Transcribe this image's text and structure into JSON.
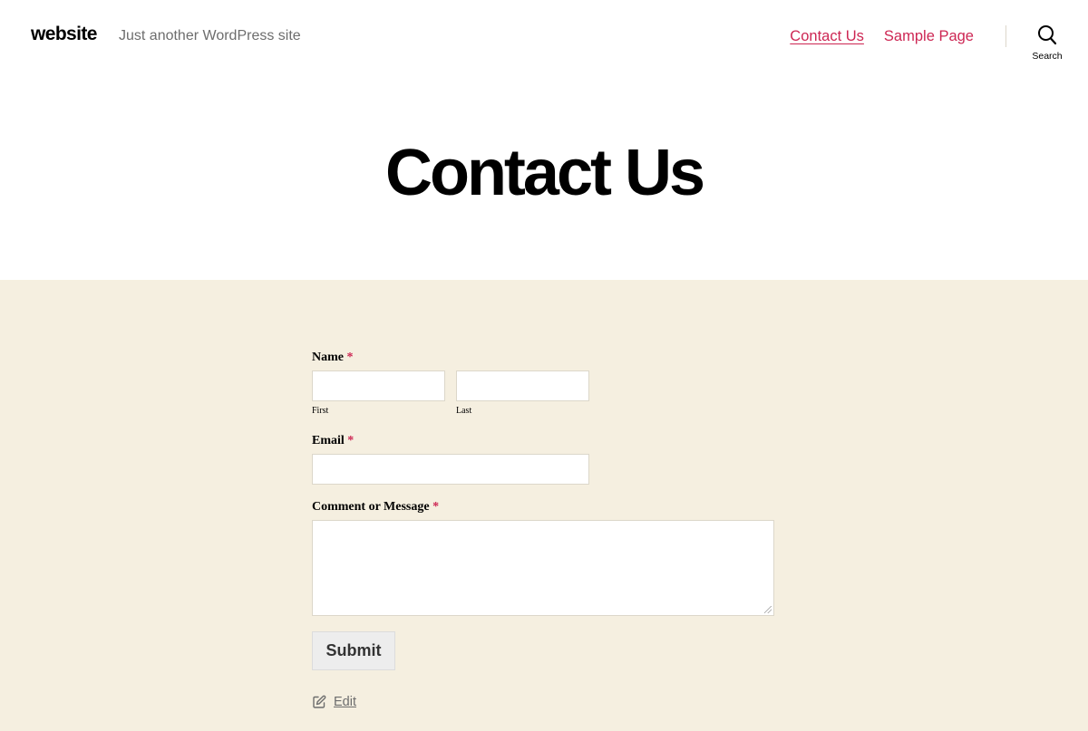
{
  "header": {
    "site_title": "website",
    "tagline": "Just another WordPress site",
    "nav": [
      {
        "label": "Contact Us"
      },
      {
        "label": "Sample Page"
      }
    ],
    "search_label": "Search"
  },
  "page": {
    "title": "Contact Us"
  },
  "form": {
    "name_label": "Name",
    "required_marker": "*",
    "first_label": "First",
    "last_label": "Last",
    "first_value": "",
    "last_value": "",
    "email_label": "Email",
    "email_value": "",
    "message_label": "Comment or Message",
    "message_value": "",
    "submit_label": "Submit"
  },
  "edit_link": {
    "label": "Edit"
  },
  "colors": {
    "accent": "#cd2653",
    "content_bg": "#f5efe0",
    "muted_text": "#6d6d6d"
  },
  "icons": {
    "search": "search-icon",
    "edit": "edit-icon"
  }
}
